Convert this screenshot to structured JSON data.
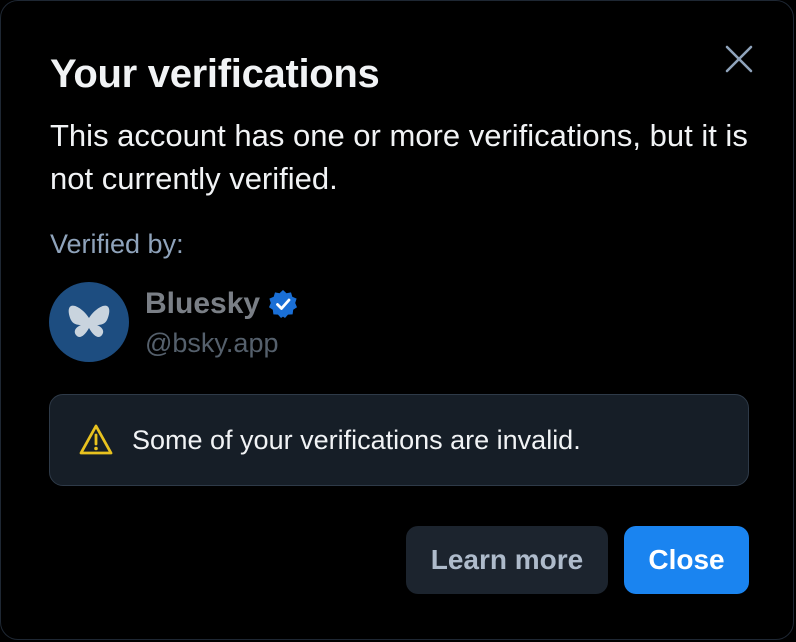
{
  "dialog": {
    "title": "Your verifications",
    "description": "This account has one or more verifications, but it is not currently verified.",
    "verified_by_label": "Verified by:",
    "verifier": {
      "name": "Bluesky",
      "handle": "@bsky.app",
      "avatar_icon": "butterfly-icon",
      "badge_icon": "verified-check-icon",
      "badge_color": "#1a6fd6"
    },
    "warning": {
      "icon": "warning-triangle-icon",
      "icon_color": "#e8c21f",
      "text": "Some of your verifications are invalid."
    },
    "buttons": {
      "learn_more": "Learn more",
      "close": "Close"
    },
    "close_icon": "close-icon",
    "colors": {
      "background": "#000000",
      "primary": "#1a84f0",
      "secondary_button": "#1c242e",
      "warning_bg": "#161e27"
    }
  }
}
